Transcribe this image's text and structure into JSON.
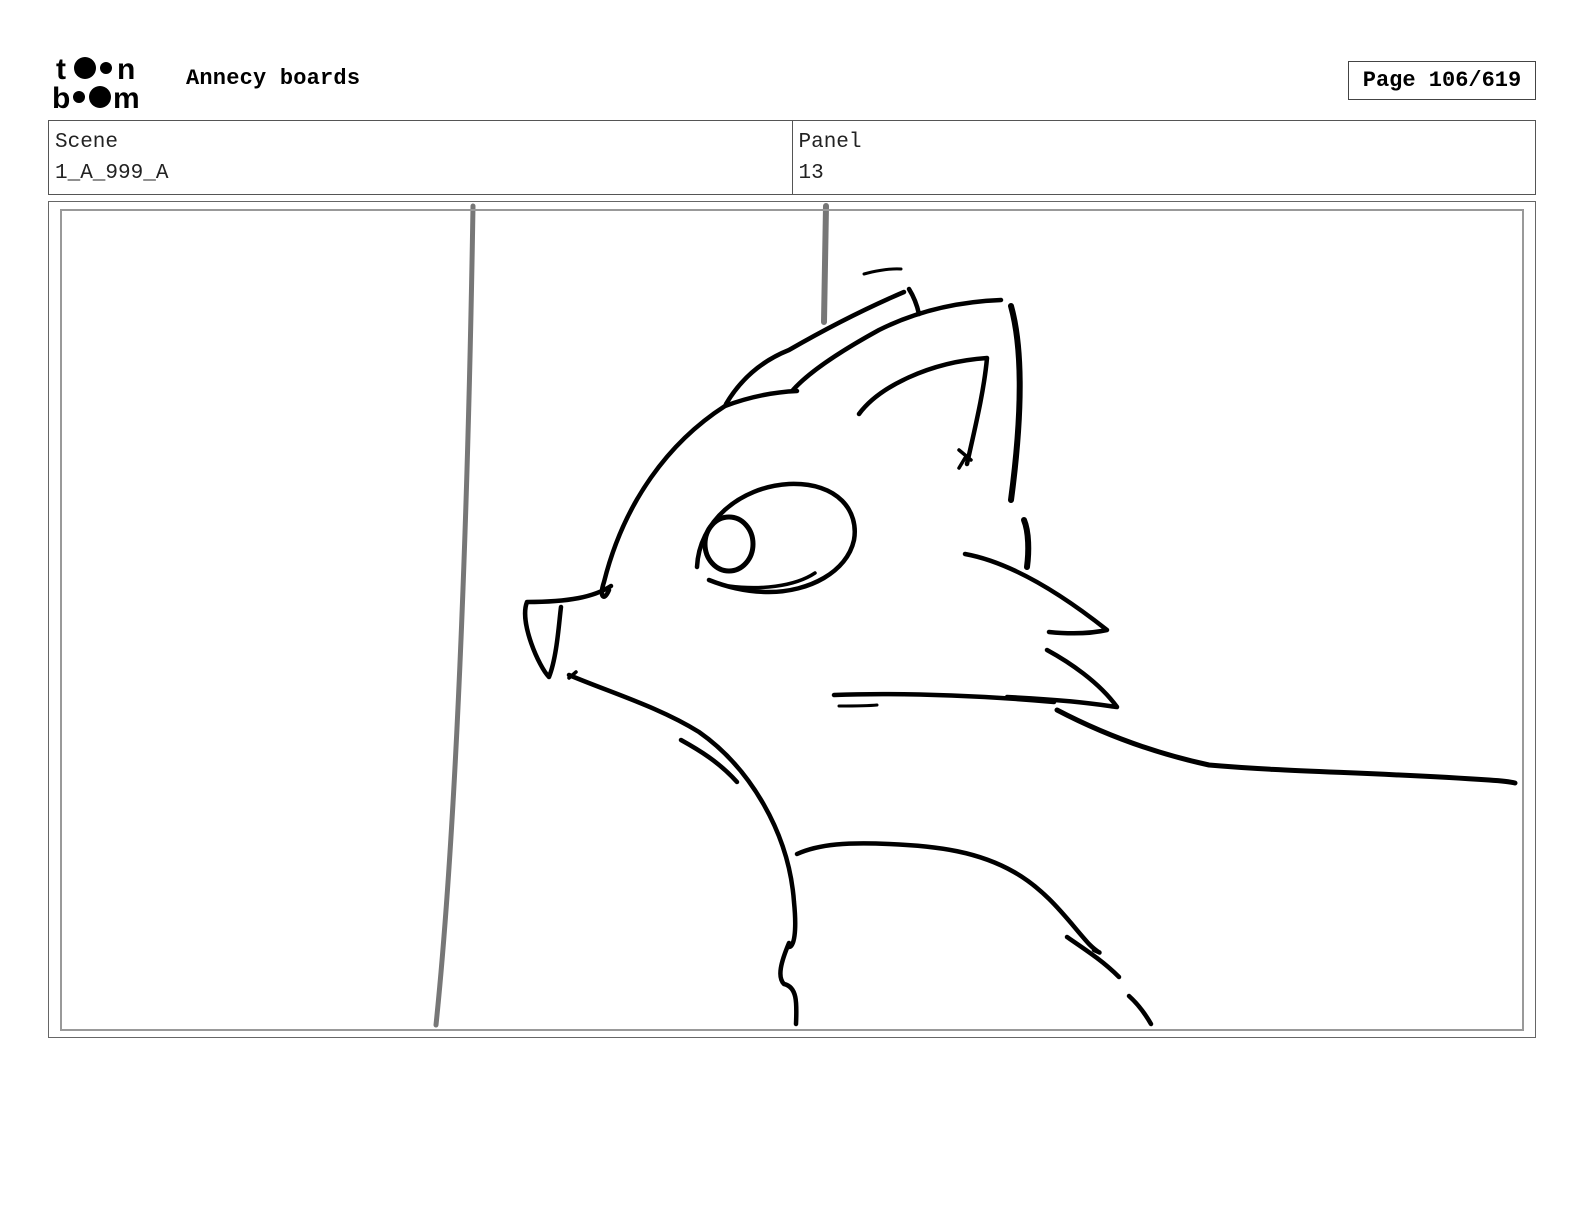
{
  "header": {
    "logo_name": "toon boom",
    "logo_line1": "t",
    "logo_line1_end": "n",
    "logo_line2_start": "b",
    "logo_line2_end": "m",
    "project_title": "Annecy boards",
    "page_label": "Page 106/619"
  },
  "info": {
    "scene_label": "Scene",
    "scene_value": "1_A_999_A",
    "panel_label": "Panel",
    "panel_value": "13"
  },
  "panel_image": {
    "description_icon": "storyboard-sketch-cat"
  }
}
